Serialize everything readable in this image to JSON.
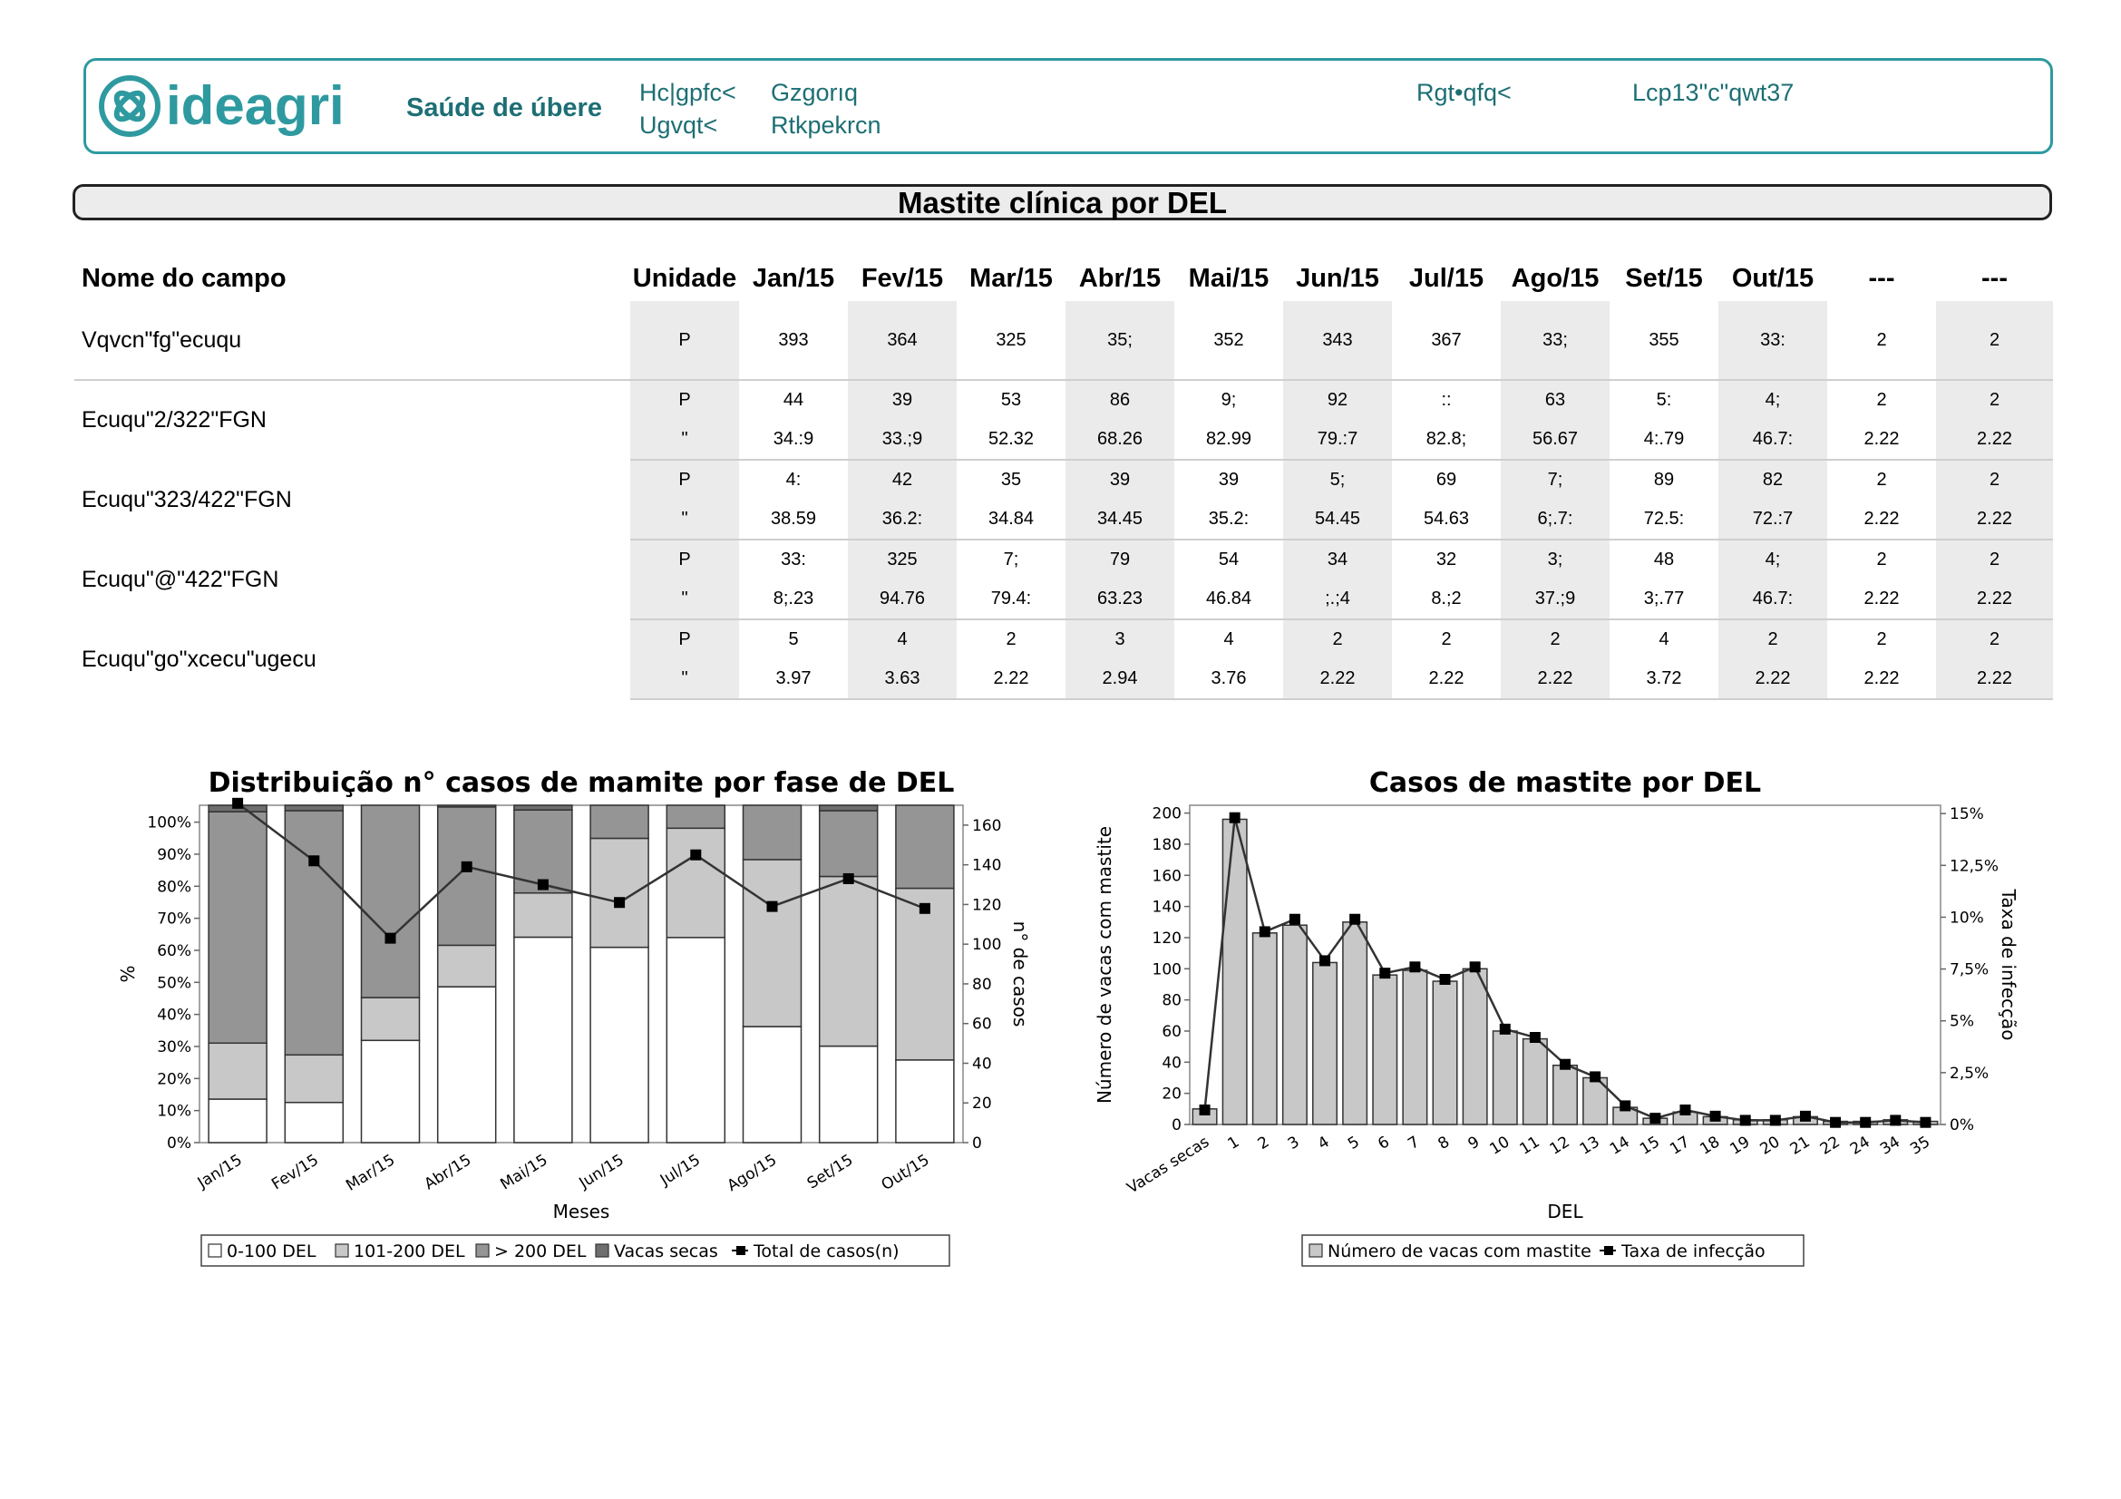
{
  "header": {
    "brand": "ideagri",
    "module": "Saúde de úbere",
    "fields": [
      "Hc|gpfc<",
      "Gzgorıq",
      "Ugvqt<",
      "Rtkpekrcn",
      "Rgt•qfq<",
      "Lcp13\"c\"qwt37"
    ]
  },
  "report": {
    "title": "Mastite clínica por DEL"
  },
  "table": {
    "columns": [
      "Nome do campo",
      "Unidade",
      "Jan/15",
      "Fev/15",
      "Mar/15",
      "Abr/15",
      "Mai/15",
      "Jun/15",
      "Jul/15",
      "Ago/15",
      "Set/15",
      "Out/15",
      "---",
      "---"
    ],
    "groups": [
      {
        "label": "Vqvcn\"fg\"ecuqu",
        "rows": [
          {
            "unit": "P",
            "values": [
              "393",
              "364",
              "325",
              "35;",
              "352",
              "343",
              "367",
              "33;",
              "355",
              "33:",
              "2",
              "2"
            ]
          }
        ]
      },
      {
        "label": "Ecuqu\"2/322\"FGN",
        "rows": [
          {
            "unit": "P",
            "values": [
              "44",
              "39",
              "53",
              "86",
              "9;",
              "92",
              "::",
              "63",
              "5:",
              "4;",
              "2",
              "2"
            ]
          },
          {
            "unit": "\"",
            "values": [
              "34.:9",
              "33.;9",
              "52.32",
              "68.26",
              "82.99",
              "79.:7",
              "82.8;",
              "56.67",
              "4:.79",
              "46.7:",
              "2.22",
              "2.22"
            ]
          }
        ]
      },
      {
        "label": "Ecuqu\"323/422\"FGN",
        "rows": [
          {
            "unit": "P",
            "values": [
              "4:",
              "42",
              "35",
              "39",
              "39",
              "5;",
              "69",
              "7;",
              "89",
              "82",
              "2",
              "2"
            ]
          },
          {
            "unit": "\"",
            "values": [
              "38.59",
              "36.2:",
              "34.84",
              "34.45",
              "35.2:",
              "54.45",
              "54.63",
              "6;.7:",
              "72.5:",
              "72.:7",
              "2.22",
              "2.22"
            ]
          }
        ]
      },
      {
        "label": "Ecuqu\"@\"422\"FGN",
        "rows": [
          {
            "unit": "P",
            "values": [
              "33:",
              "325",
              "7;",
              "79",
              "54",
              "34",
              "32",
              "3;",
              "48",
              "4;",
              "2",
              "2"
            ]
          },
          {
            "unit": "\"",
            "values": [
              "8;.23",
              "94.76",
              "79.4:",
              "63.23",
              "46.84",
              ";.;4",
              "8.;2",
              "37.;9",
              "3;.77",
              "46.7:",
              "2.22",
              "2.22"
            ]
          }
        ]
      },
      {
        "label": "Ecuqu\"go\"xcecu\"ugecu",
        "rows": [
          {
            "unit": "P",
            "values": [
              "5",
              "4",
              "2",
              "3",
              "4",
              "2",
              "2",
              "2",
              "4",
              "2",
              "2",
              "2"
            ]
          },
          {
            "unit": "\"",
            "values": [
              "3.97",
              "3.63",
              "2.22",
              "2.94",
              "3.76",
              "2.22",
              "2.22",
              "2.22",
              "3.72",
              "2.22",
              "2.22",
              "2.22"
            ]
          }
        ]
      }
    ]
  },
  "chart_data": [
    {
      "type": "bar",
      "stacked": true,
      "title": "Distribuição n° casos de mamite por fase de DEL",
      "xlabel": "Meses",
      "ylabel": "%",
      "y2label": "n° de casos",
      "categories": [
        "Jan/15",
        "Fev/15",
        "Mar/15",
        "Abr/15",
        "Mai/15",
        "Jun/15",
        "Jul/15",
        "Ago/15",
        "Set/15",
        "Out/15"
      ],
      "ylim": [
        0,
        100
      ],
      "y2lim": [
        0,
        170
      ],
      "yticks": [
        "0%",
        "10%",
        "20%",
        "30%",
        "40%",
        "50%",
        "60%",
        "70%",
        "80%",
        "90%",
        "100%"
      ],
      "y2ticks": [
        "0",
        "20",
        "40",
        "60",
        "80",
        "100",
        "120",
        "140",
        "160"
      ],
      "series": [
        {
          "name": "0-100 DEL",
          "color": "#ffffff",
          "values": [
            12.9,
            11.9,
            30.3,
            46.2,
            60.9,
            57.9,
            60.8,
            34.4,
            28.6,
            24.5
          ]
        },
        {
          "name": "101-200 DEL",
          "color": "#c8c8c8",
          "values": [
            16.6,
            14.1,
            12.7,
            12.3,
            13.1,
            32.3,
            32.4,
            49.5,
            50.3,
            50.9
          ]
        },
        {
          "name": "> 200 DEL",
          "color": "#959595",
          "values": [
            68.6,
            72.4,
            57.0,
            41.0,
            24.6,
            9.8,
            6.8,
            16.1,
            19.5,
            24.6
          ]
        },
        {
          "name": "Vacas secas",
          "color": "#6e6e6e",
          "values": [
            1.9,
            1.6,
            0.0,
            0.5,
            1.4,
            0.0,
            0.0,
            0.0,
            1.6,
            0.0
          ]
        }
      ],
      "line": {
        "name": "Total de casos(n)",
        "values": [
          171,
          142,
          103,
          139,
          130,
          121,
          145,
          119,
          133,
          118
        ]
      },
      "legend": "bottom"
    },
    {
      "type": "bar",
      "title": "Casos de mastite por DEL",
      "xlabel": "DEL",
      "ylabel": "Número de vacas com mastite",
      "y2label": "Taxa de infecção",
      "categories": [
        "Vacas secas",
        "1",
        "2",
        "3",
        "4",
        "5",
        "6",
        "7",
        "8",
        "9",
        "10",
        "11",
        "12",
        "13",
        "14",
        "15",
        "17",
        "18",
        "19",
        "20",
        "21",
        "22",
        "24",
        "34",
        "35"
      ],
      "ylim": [
        0,
        205
      ],
      "y2lim": [
        0,
        15.4
      ],
      "yticks": [
        "0",
        "20",
        "40",
        "60",
        "80",
        "100",
        "120",
        "140",
        "160",
        "180",
        "200"
      ],
      "y2ticks": [
        "0%",
        "2,5%",
        "5%",
        "7,5%",
        "10%",
        "12,5%",
        "15%"
      ],
      "series": [
        {
          "name": "Número de vacas com mastite",
          "color": "#c8c8c8",
          "values": [
            10,
            196,
            123,
            128,
            104,
            130,
            96,
            99,
            92,
            100,
            60,
            55,
            38,
            30,
            11,
            4,
            8,
            5,
            3,
            3,
            5,
            2,
            2,
            3,
            2
          ]
        }
      ],
      "line": {
        "name": "Taxa de infecção",
        "values": [
          0.7,
          14.8,
          9.3,
          9.9,
          7.9,
          9.9,
          7.3,
          7.6,
          7.0,
          7.6,
          4.6,
          4.2,
          2.9,
          2.3,
          0.9,
          0.3,
          0.7,
          0.4,
          0.2,
          0.2,
          0.4,
          0.1,
          0.1,
          0.2,
          0.1
        ]
      },
      "legend": "bottom"
    }
  ]
}
